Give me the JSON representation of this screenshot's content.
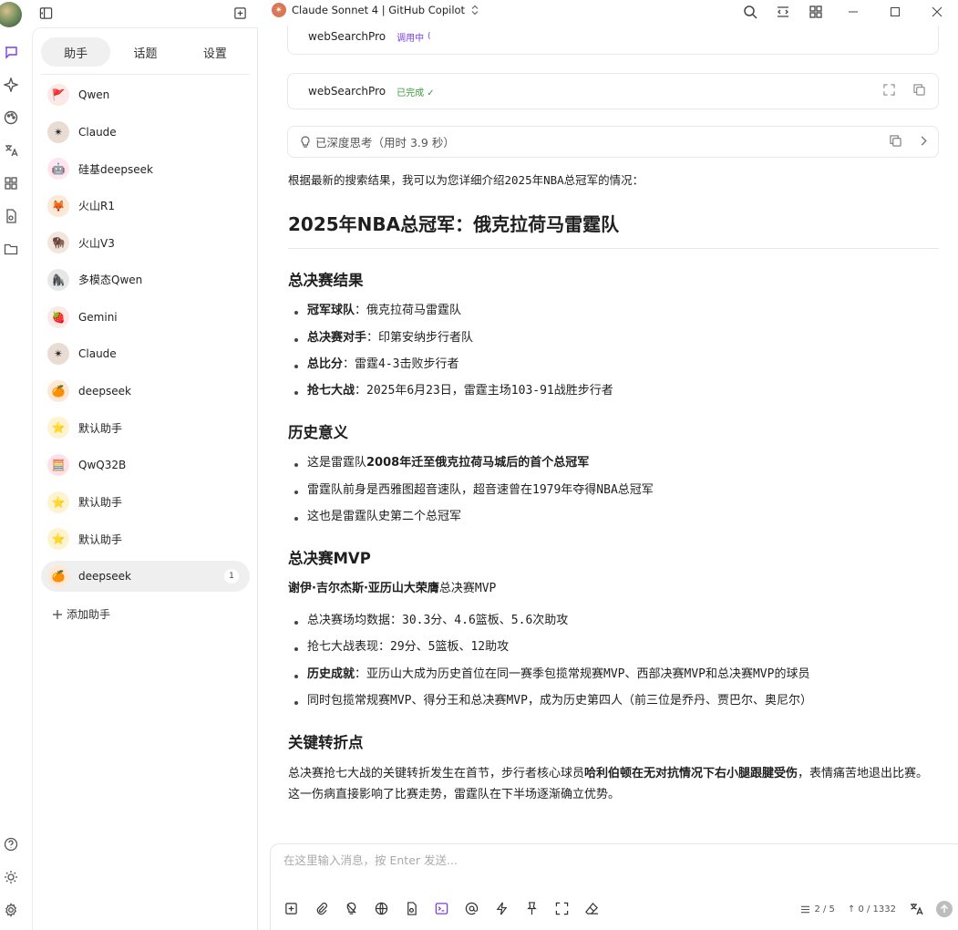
{
  "window": {
    "model_name": "Claude Sonnet 4 | GitHub Copilot"
  },
  "sidebar": {
    "tabs": [
      {
        "label": "助手",
        "active": true
      },
      {
        "label": "话题",
        "active": false
      },
      {
        "label": "设置",
        "active": false
      }
    ],
    "assistants": [
      {
        "name": "Qwen",
        "icon": "red-flag-emoji",
        "bg": "#fde8e8",
        "glyph": "🚩"
      },
      {
        "name": "Claude",
        "icon": "claude-logo-emoji",
        "bg": "#e9dcd3",
        "glyph": "✴"
      },
      {
        "name": "硅基deepseek",
        "icon": "silicon-robot-emoji",
        "bg": "#fde6f0",
        "glyph": "🤖"
      },
      {
        "name": "火山R1",
        "icon": "fox-emoji",
        "bg": "#fde8d6",
        "glyph": "🦊"
      },
      {
        "name": "火山V3",
        "icon": "bison-emoji",
        "bg": "#f1e6dc",
        "glyph": "🦬"
      },
      {
        "name": "多模态Qwen",
        "icon": "gorilla-emoji",
        "bg": "#e7e7e7",
        "glyph": "🦍"
      },
      {
        "name": "Gemini",
        "icon": "strawberry-emoji",
        "bg": "#fde8e8",
        "glyph": "🍓"
      },
      {
        "name": "Claude",
        "icon": "claude-logo-emoji",
        "bg": "#e9dcd3",
        "glyph": "✴"
      },
      {
        "name": "deepseek",
        "icon": "tangerine-emoji",
        "bg": "#fde8d6",
        "glyph": "🍊"
      },
      {
        "name": "默认助手",
        "icon": "star-emoji",
        "bg": "#fdf3d0",
        "glyph": "⭐"
      },
      {
        "name": "QwQ32B",
        "icon": "abacus-emoji",
        "bg": "#fde0e8",
        "glyph": "🧮"
      },
      {
        "name": "默认助手",
        "icon": "star-emoji",
        "bg": "#fdf3d0",
        "glyph": "⭐"
      },
      {
        "name": "默认助手",
        "icon": "star-emoji",
        "bg": "#fdf3d0",
        "glyph": "⭐"
      },
      {
        "name": "deepseek",
        "icon": "tangerine-emoji",
        "bg": "#fde8d6",
        "glyph": "🍊",
        "active": true,
        "badge": "1"
      }
    ],
    "add_label": "添加助手"
  },
  "tools": [
    {
      "name": "webSearchPro",
      "status": "调用中",
      "state": "calling"
    },
    {
      "name": "webSearchPro",
      "status": "已完成 ✓",
      "state": "done"
    }
  ],
  "thinking": {
    "label": "已深度思考（用时 3.9 秒）"
  },
  "message": {
    "intro": "根据最新的搜索结果，我可以为您详细介绍2025年NBA总冠军的情况：",
    "title": "2025年NBA总冠军：俄克拉荷马雷霆队",
    "sections": {
      "finals": {
        "heading": "总决赛结果",
        "items": [
          {
            "bold": "冠军球队",
            "text": "：俄克拉荷马雷霆队"
          },
          {
            "bold": "总决赛对手",
            "text": "：印第安纳步行者队"
          },
          {
            "bold": "总比分",
            "text": "：雷霆4-3击败步行者"
          },
          {
            "bold": "抢七大战",
            "text": "：2025年6月23日，雷霆主场103-91战胜步行者"
          }
        ]
      },
      "history": {
        "heading": "历史意义",
        "items": [
          {
            "prefix": "这是雷霆队",
            "bold": "2008年迁至俄克拉荷马城后的首个总冠军"
          },
          {
            "text": "雷霆队前身是西雅图超音速队，超音速曾在1979年夺得NBA总冠军"
          },
          {
            "text": "这也是雷霆队史第二个总冠军"
          }
        ]
      },
      "mvp": {
        "heading": "总决赛MVP",
        "line_bold": "谢伊·吉尔杰斯·亚历山大荣膺",
        "line_text": "总决赛MVP",
        "items": [
          {
            "text": "总决赛场均数据：30.3分、4.6篮板、5.6次助攻"
          },
          {
            "text": "抢七大战表现：29分、5篮板、12助攻"
          },
          {
            "bold": "历史成就",
            "text": "：亚历山大成为历史首位在同一赛季包揽常规赛MVP、西部决赛MVP和总决赛MVP的球员"
          },
          {
            "text": "同时包揽常规赛MVP、得分王和总决赛MVP，成为历史第四人（前三位是乔丹、贾巴尔、奥尼尔）"
          }
        ]
      },
      "turning": {
        "heading": "关键转折点",
        "para_a": "总决赛抢七大战的关键转折发生在首节，步行者核心球员",
        "para_bold": "哈利伯顿在无对抗情况下右小腿跟腱受伤",
        "para_b": "，表情痛苦地退出比赛。这一伤病直接影响了比赛走势，雷霆队在下半场逐渐确立优势。"
      }
    }
  },
  "composer": {
    "placeholder": "在这里输入消息，按 Enter 发送...",
    "context_count": "2 / 5",
    "token_count": "↑ 0 / 1332"
  },
  "colors": {
    "accent": "#7b3fe4",
    "done": "#3a9a3a"
  }
}
